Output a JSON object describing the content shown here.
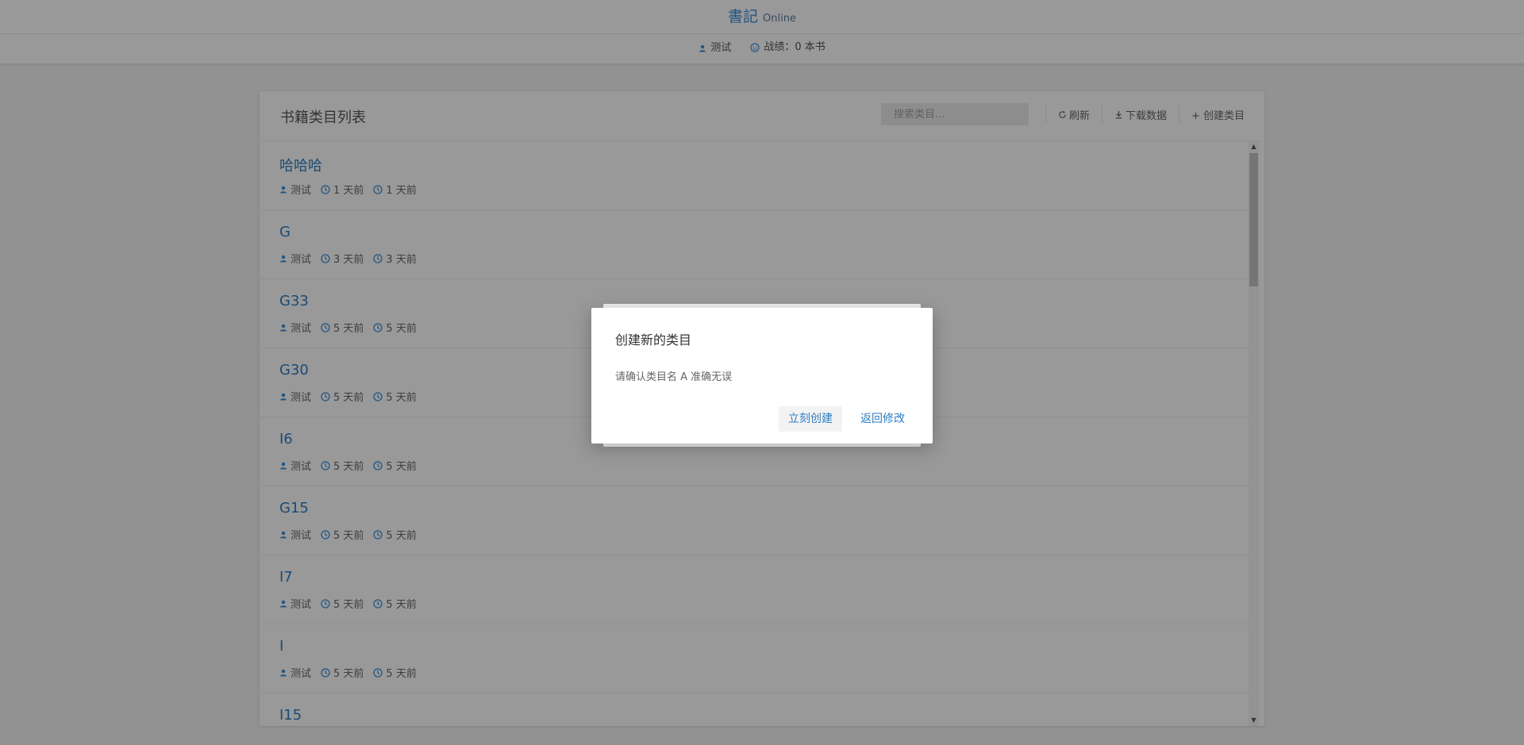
{
  "header": {
    "title": "書記",
    "subtitle": "Online",
    "user": "测试",
    "record_label": "战绩：0 本书"
  },
  "panel": {
    "title": "书籍类目列表",
    "search_placeholder": "搜索类目...",
    "refresh_label": "刷新",
    "download_label": "下载数据",
    "create_label": "+ 创建类目"
  },
  "categories": [
    {
      "name": "哈哈哈",
      "user": "测试",
      "created": "1 天前",
      "updated": "1 天前"
    },
    {
      "name": "G",
      "user": "测试",
      "created": "3 天前",
      "updated": "3 天前"
    },
    {
      "name": "G33",
      "user": "测试",
      "created": "5 天前",
      "updated": "5 天前"
    },
    {
      "name": "G30",
      "user": "测试",
      "created": "5 天前",
      "updated": "5 天前"
    },
    {
      "name": "I6",
      "user": "测试",
      "created": "5 天前",
      "updated": "5 天前"
    },
    {
      "name": "G15",
      "user": "测试",
      "created": "5 天前",
      "updated": "5 天前"
    },
    {
      "name": "I7",
      "user": "测试",
      "created": "5 天前",
      "updated": "5 天前"
    },
    {
      "name": "I",
      "user": "测试",
      "created": "5 天前",
      "updated": "5 天前"
    },
    {
      "name": "I15",
      "user": "",
      "created": "",
      "updated": ""
    }
  ],
  "dialog": {
    "title": "创建新的类目",
    "message": "请确认类目名 A 准确无误",
    "confirm_label": "立刻创建",
    "back_label": "返回修改"
  },
  "colors": {
    "accent": "#2f7dc2",
    "overlay": "rgba(0,0,0,0.40)"
  }
}
